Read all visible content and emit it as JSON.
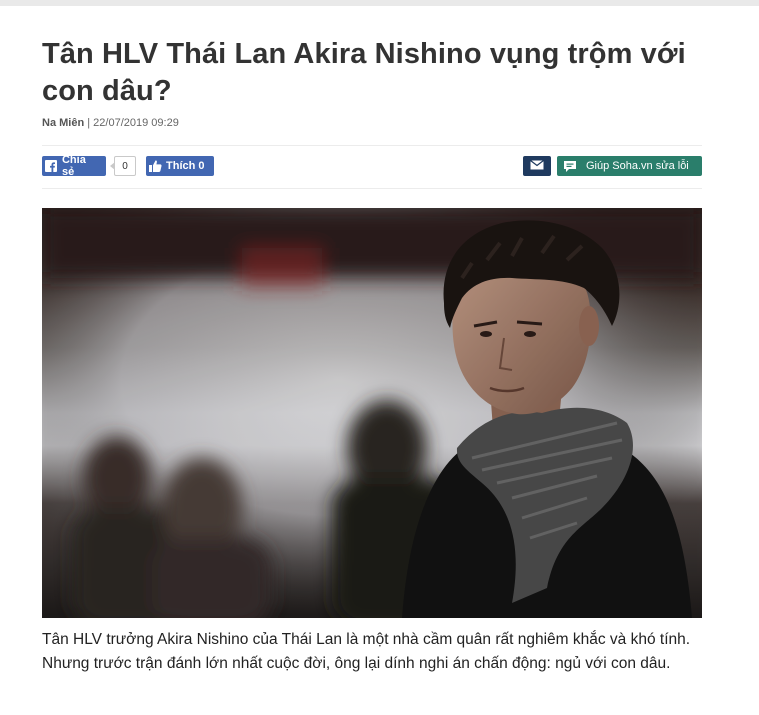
{
  "article": {
    "title": "Tân HLV Thái Lan Akira Nishino vụng trộm với con dâu?",
    "author": "Na Miên",
    "separator": "|",
    "datetime": "22/07/2019 09:29",
    "caption": "Tân HLV trưởng Akira Nishino của Thái Lan là một nhà cầm quân rất nghiêm khắc và khó tính. Nhưng trước trận đánh lớn nhất cuộc đời, ông lại dính nghi án chấn động: ngủ với con dâu."
  },
  "social": {
    "share_label": "Chia sẻ",
    "share_count": "0",
    "like_label": "Thích 0",
    "report_label": "Giúp Soha.vn sửa lỗi",
    "icons": {
      "share": "facebook-icon",
      "like": "thumbs-up-icon",
      "mail": "mail-icon",
      "report": "chat-bubble-icon"
    }
  },
  "colors": {
    "facebook": "#4267b2",
    "mail": "#1f3a5f",
    "report": "#2a7e6b"
  }
}
